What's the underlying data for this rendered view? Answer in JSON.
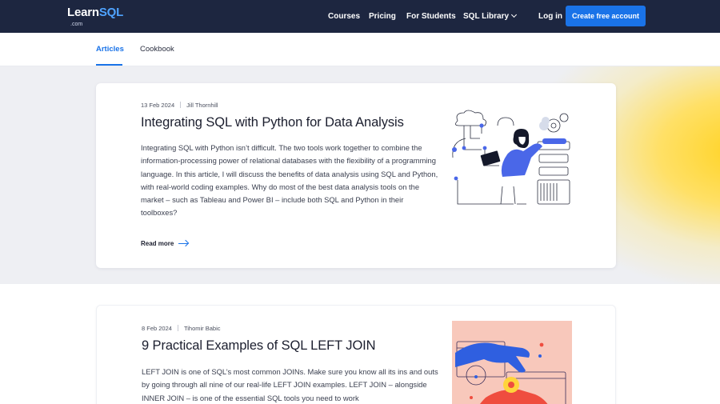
{
  "header": {
    "logo_main": "Learn",
    "logo_accent": "SQL",
    "logo_suffix": ".com",
    "nav": [
      "Courses",
      "Pricing",
      "For Students",
      "SQL Library"
    ],
    "login": "Log in",
    "cta": "Create free account"
  },
  "tabs": [
    {
      "label": "Articles",
      "active": true
    },
    {
      "label": "Cookbook",
      "active": false
    }
  ],
  "articles": [
    {
      "date": "13 Feb 2024",
      "author": "Jill Thornhill",
      "title": "Integrating SQL with Python for Data Analysis",
      "excerpt": "Integrating SQL with Python isn’t difficult. The two tools work together to combine the information-processing power of relational databases with the flexibility of a programming language. In this article, I will discuss the benefits of data analysis using SQL and Python, with real-world coding examples. Why do most of the best data analysis tools on the market – such as Tableau and Power BI – include both SQL and Python in their toolboxes?",
      "read_more": "Read more"
    },
    {
      "date": "8 Feb 2024",
      "author": "Tihomir Babic",
      "title": "9 Practical Examples of SQL LEFT JOIN",
      "excerpt": "LEFT JOIN is one of SQL’s most common JOINs. Make sure you know all its ins and outs by going through all nine of our real-life LEFT JOIN examples. LEFT JOIN – alongside INNER JOIN – is one of the essential SQL tools you need to work"
    }
  ],
  "colors": {
    "header_bg": "#1d2640",
    "accent": "#1a73e8",
    "band_bg": "#eeeff3",
    "glow": "#ffd21f"
  }
}
